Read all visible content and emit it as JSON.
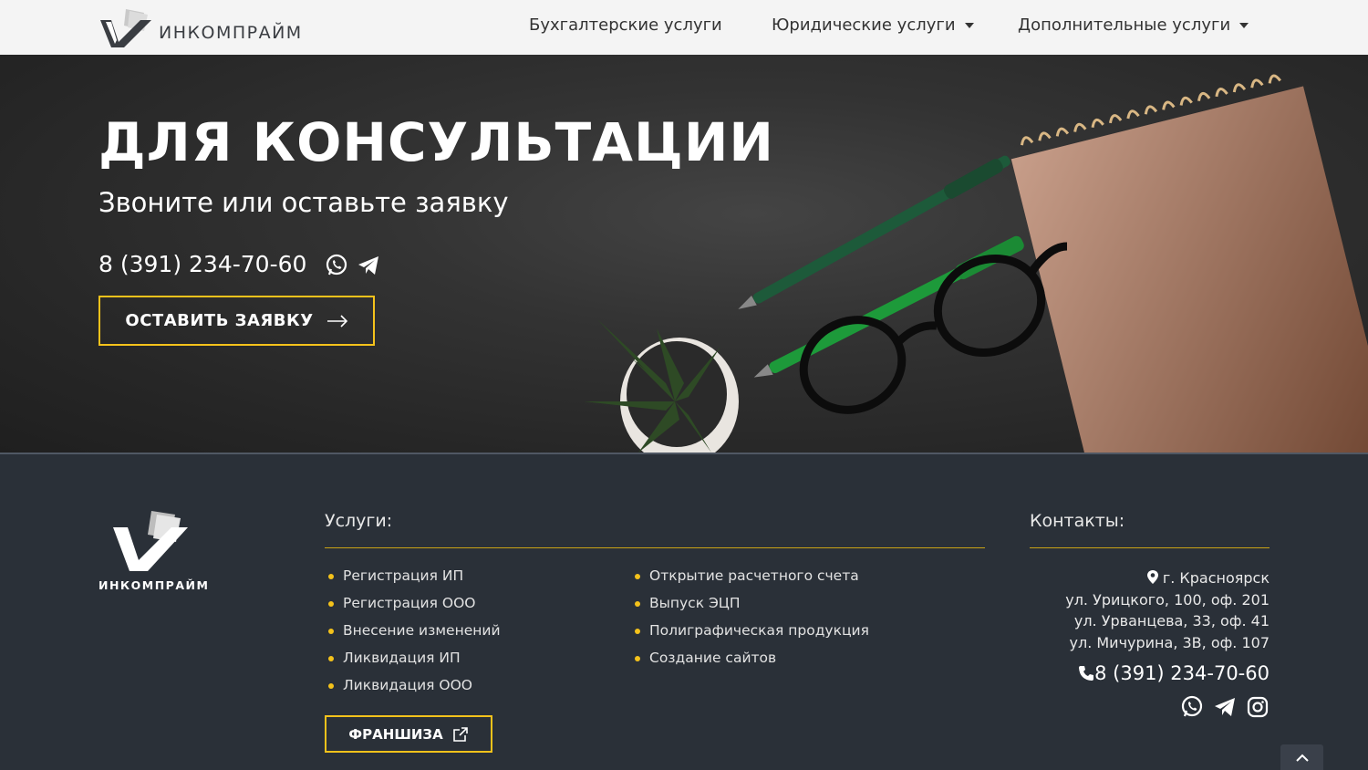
{
  "header": {
    "logo_text": "ИНКОМПРАЙМ",
    "nav": [
      {
        "label": "Бухгалтерские услуги",
        "has_dropdown": false
      },
      {
        "label": "Юридические услуги",
        "has_dropdown": true
      },
      {
        "label": "Дополнительные услуги",
        "has_dropdown": true
      }
    ]
  },
  "hero": {
    "title": "ДЛЯ КОНСУЛЬТАЦИИ",
    "subtitle": "Звоните или оставьте заявку",
    "phone": "8 (391) 234-70-60",
    "icons": [
      "whatsapp-icon",
      "telegram-icon"
    ],
    "cta_label": "ОСТАВИТЬ ЗАЯВКУ"
  },
  "footer": {
    "logo_text": "ИНКОМПРАЙМ",
    "services_heading": "Услуги:",
    "services_col1": [
      "Регистрация ИП",
      "Регистрация ООО",
      "Внесение изменений",
      "Ликвидация ИП",
      "Ликвидация ООО"
    ],
    "services_col2": [
      "Открытие расчетного счета",
      "Выпуск ЭЦП",
      "Полиграфическая продукция",
      "Создание сайтов"
    ],
    "franchise_label": "ФРАНШИЗА",
    "contacts_heading": "Контакты:",
    "city": "г. Красноярск",
    "addresses": [
      "ул. Урицкого, 100, оф. 201",
      "ул. Урванцева, 33, оф. 41",
      "ул. Мичурина, 3В, оф. 107"
    ],
    "phone": "8 (391) 234-70-60",
    "socials": [
      "whatsapp-icon",
      "telegram-icon",
      "instagram-icon"
    ]
  },
  "colors": {
    "accent": "#f4c21b",
    "footer_bg": "#2a3038",
    "header_bg": "#f4f4f4"
  }
}
